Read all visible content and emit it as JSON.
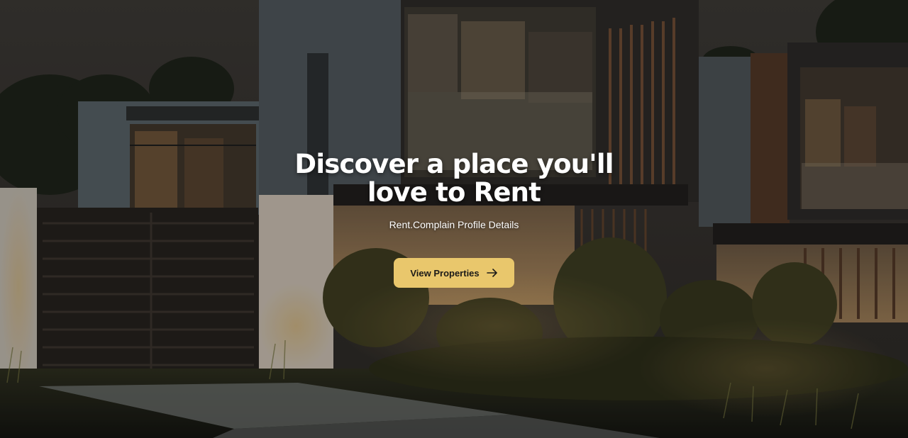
{
  "hero": {
    "title_line1": "Discover a place you'll",
    "title_line2": "love to Rent",
    "subtitle": "Rent.Complain Profile Details",
    "cta_label": "View Properties",
    "cta_icon": "arrow-right-icon",
    "background": "modern-house-night-photo"
  },
  "colors": {
    "accent": "#e9c76c",
    "text": "#ffffff",
    "button_text": "#1b1a18"
  }
}
